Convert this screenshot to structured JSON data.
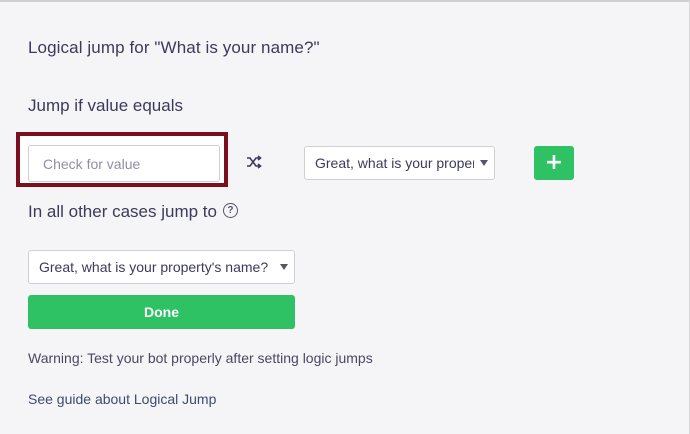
{
  "header": {
    "title": "Logical jump for \"What is your name?\""
  },
  "jump_rule": {
    "label": "Jump if value equals",
    "value_placeholder": "Check for value",
    "value": "",
    "target_selected": "Great, what is your property's name?",
    "add_label": "+"
  },
  "fallback": {
    "label": "In all other cases jump to",
    "help_glyph": "?",
    "target_selected": "Great, what is your property's name?"
  },
  "actions": {
    "done_label": "Done"
  },
  "footer": {
    "warning": "Warning: Test your bot properly after setting logic jumps",
    "guide_link": "See guide about Logical Jump"
  },
  "colors": {
    "accent_green": "#2ec265",
    "highlight_border": "#7b0f1e",
    "text_primary": "#3c3a5a"
  },
  "icons": {
    "condition_icon": "shuffle-icon",
    "help_icon": "question-circle-icon",
    "dropdown_icon": "caret-down-icon"
  }
}
